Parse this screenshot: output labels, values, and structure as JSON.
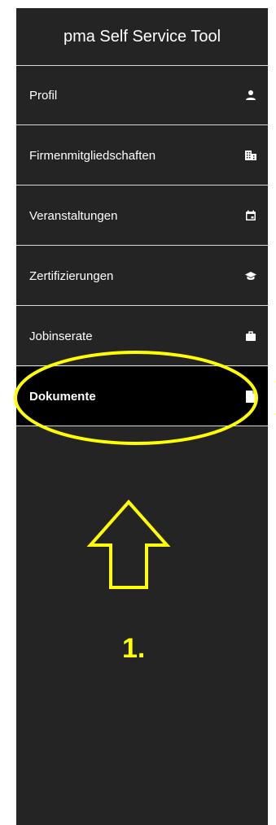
{
  "sidebar": {
    "brand": "pma Self Service Tool",
    "items": [
      {
        "label": "Profil",
        "icon": "person-icon",
        "active": false
      },
      {
        "label": "Firmenmitgliedschaften",
        "icon": "building-icon",
        "active": false
      },
      {
        "label": "Veranstaltungen",
        "icon": "calendar-icon",
        "active": false
      },
      {
        "label": "Zertifizierungen",
        "icon": "graduation-cap-icon",
        "active": false
      },
      {
        "label": "Jobinserate",
        "icon": "briefcase-icon",
        "active": false
      },
      {
        "label": "Dokumente",
        "icon": "document-icon",
        "active": true
      }
    ]
  },
  "annotation": {
    "step": "1.",
    "color": "#ffff00"
  },
  "colors": {
    "sidebar_bg": "#242424",
    "active_bg": "#000000",
    "divider": "#d8d8d8",
    "text": "#ffffff"
  }
}
